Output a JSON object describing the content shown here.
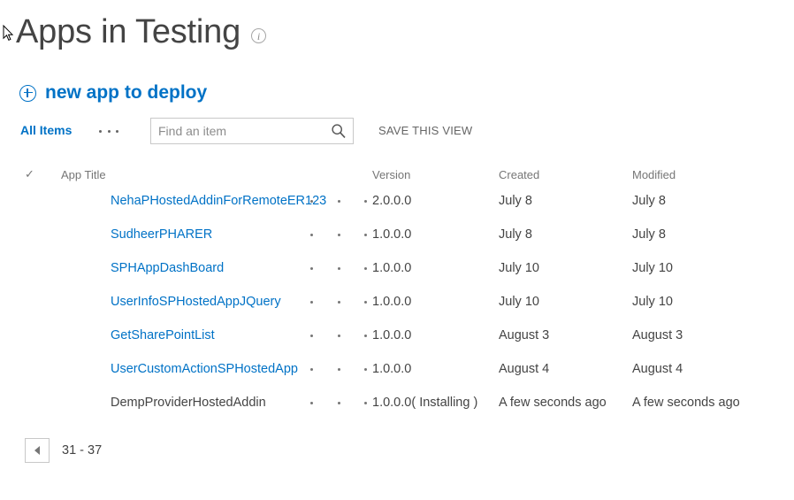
{
  "header": {
    "title": "Apps in Testing",
    "info_icon": "info-icon",
    "info_glyph": "i"
  },
  "new_app": {
    "label": "new app to deploy",
    "icon": "plus-circle-icon"
  },
  "toolbar": {
    "view_tab": "All Items",
    "view_ellipsis": "ellipsis-icon",
    "search_placeholder": "Find an item",
    "search_value": "",
    "search_icon": "search-icon",
    "save_view_label": "SAVE THIS VIEW"
  },
  "table": {
    "select_all_icon": "checkmark-icon",
    "columns": [
      "App Title",
      "Version",
      "Created",
      "Modified"
    ],
    "row_menu_icon": "ellipsis-icon",
    "rows": [
      {
        "title": "NehaPHostedAddinForRemoteER123",
        "is_link": true,
        "version": "2.0.0.0",
        "created": "July 8",
        "modified": "July 8"
      },
      {
        "title": "SudheerPHARER",
        "is_link": true,
        "version": "1.0.0.0",
        "created": "July 8",
        "modified": "July 8"
      },
      {
        "title": "SPHAppDashBoard",
        "is_link": true,
        "version": "1.0.0.0",
        "created": "July 10",
        "modified": "July 10"
      },
      {
        "title": "UserInfoSPHostedAppJQuery",
        "is_link": true,
        "version": "1.0.0.0",
        "created": "July 10",
        "modified": "July 10"
      },
      {
        "title": "GetSharePointList",
        "is_link": true,
        "version": "1.0.0.0",
        "created": "August 3",
        "modified": "August 3"
      },
      {
        "title": "UserCustomActionSPHostedApp",
        "is_link": true,
        "version": "1.0.0.0",
        "created": "August 4",
        "modified": "August 4"
      },
      {
        "title": "DempProviderHostedAddin",
        "is_link": false,
        "version": "1.0.0.0( Installing )",
        "created": "A few seconds ago",
        "modified": "A few seconds ago"
      }
    ]
  },
  "pagination": {
    "prev_icon": "triangle-left-icon",
    "range": "31 - 37"
  },
  "colors": {
    "link": "#0072c6",
    "text": "#444444",
    "muted": "#767676",
    "border": "#c8c8c8"
  }
}
